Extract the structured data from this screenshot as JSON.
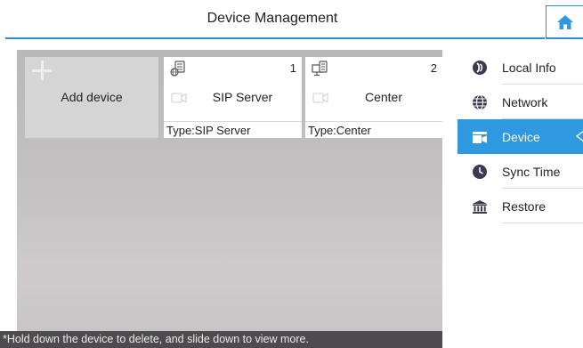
{
  "header": {
    "title": "Device Management"
  },
  "devices": {
    "add_label": "Add device",
    "items": [
      {
        "index": "1",
        "name": "SIP Server",
        "type": "Type:SIP Server",
        "icon": "server-icon"
      },
      {
        "index": "2",
        "name": "Center",
        "type": "Type:Center",
        "icon": "monitor-server-icon"
      }
    ]
  },
  "hint": "*Hold down the device to delete, and slide down to view more.",
  "sidebar": {
    "items": [
      {
        "label": "Local Info",
        "icon": "info-icon",
        "active": false
      },
      {
        "label": "Network",
        "icon": "globe-icon",
        "active": false
      },
      {
        "label": "Device",
        "icon": "device-icon",
        "active": true
      },
      {
        "label": "Sync Time",
        "icon": "clock-icon",
        "active": false
      },
      {
        "label": "Restore",
        "icon": "restore-icon",
        "active": false
      }
    ]
  },
  "colors": {
    "accent": "#2e98e0",
    "hint_bg": "#4d4b4d",
    "icon": "#3a3a50"
  }
}
